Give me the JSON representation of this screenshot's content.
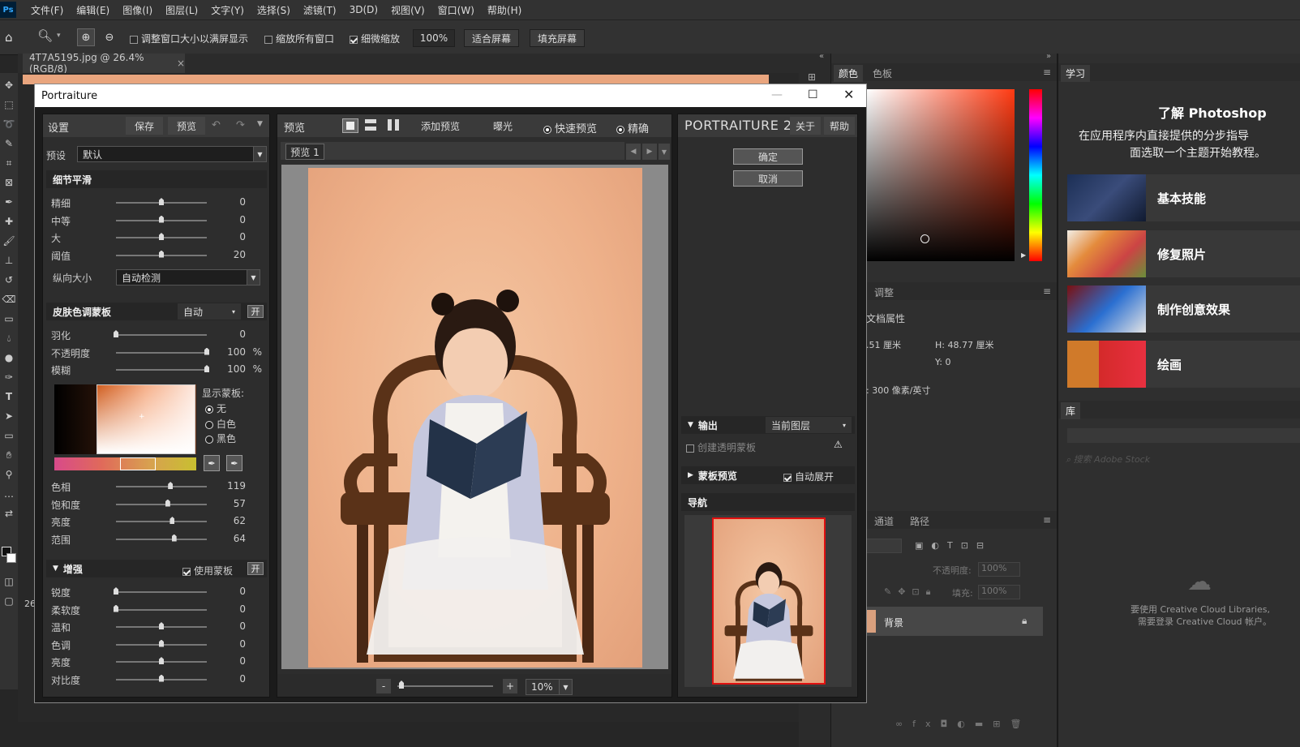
{
  "menubar": {
    "logo": "Ps",
    "items": [
      "文件(F)",
      "编辑(E)",
      "图像(I)",
      "图层(L)",
      "文字(Y)",
      "选择(S)",
      "滤镜(T)",
      "3D(D)",
      "视图(V)",
      "窗口(W)",
      "帮助(H)"
    ]
  },
  "options": {
    "resize_windows": "调整窗口大小以满屏显示",
    "zoom_all": "缩放所有窗口",
    "scrubby_zoom": "细微缩放",
    "zoom_value": "100%",
    "fit_screen": "适合屏幕",
    "fill_screen": "填充屏幕"
  },
  "document": {
    "tab_title": "4T7A5195.jpg @ 26.4%(RGB/8)",
    "close": "×",
    "zoom_readout": "26"
  },
  "right": {
    "tabs_color": [
      "颜色",
      "色板"
    ],
    "learn_tab": "学习",
    "learn_title": "了解 Photoshop",
    "learn_desc1": "在应用程序内直接提供的分步指导",
    "learn_desc2": "面选取一个主题开始教程。",
    "learn_cards": [
      "基本技能",
      "修复照片",
      "制作创意效果",
      "绘画"
    ],
    "adjust_tab": "调整",
    "doc_props": "文档属性",
    "w_val": ".51 厘米",
    "h_val": "H: 48.77 厘米",
    "y_val": "Y: 0",
    "res_val": ": 300 像素/英寸",
    "lib_tab": "库",
    "lib_search": "搜索 Adobe Stock",
    "lib_msg1": "要使用 Creative Cloud Libraries,",
    "lib_msg2": "需要登录 Creative Cloud 帐户。",
    "layers_tabs": [
      "通道",
      "路径"
    ],
    "opacity_label": "不透明度:",
    "opacity_val": "100%",
    "fill_label": "填充:",
    "fill_val": "100%",
    "layer_name": "背景"
  },
  "dialog": {
    "title": "Portraiture",
    "settings": {
      "header": "设置",
      "save": "保存",
      "preview": "预览",
      "preset_label": "预设",
      "preset_value": "默认",
      "detail_smoothing": "细节平滑",
      "detail_sliders": [
        {
          "label": "精细",
          "value": "0",
          "pos": 0.5
        },
        {
          "label": "中等",
          "value": "0",
          "pos": 0.5
        },
        {
          "label": "大",
          "value": "0",
          "pos": 0.5
        },
        {
          "label": "阈值",
          "value": "20",
          "pos": 0.5
        }
      ],
      "size_label": "纵向大小",
      "size_value": "自动检测",
      "skin_mask": "皮肤色调蒙板",
      "skin_mode": "自动",
      "on_label": "开",
      "skin_sliders": [
        {
          "label": "羽化",
          "value": "0",
          "unit": "",
          "pos": 0.0
        },
        {
          "label": "不透明度",
          "value": "100",
          "unit": "%",
          "pos": 1.0
        },
        {
          "label": "模糊",
          "value": "100",
          "unit": "%",
          "pos": 1.0
        }
      ],
      "show_mask": "显示蒙板:",
      "mask_opts": [
        "无",
        "白色",
        "黑色"
      ],
      "hsl_sliders": [
        {
          "label": "色相",
          "value": "119",
          "pos": 0.6
        },
        {
          "label": "饱和度",
          "value": "57",
          "pos": 0.57
        },
        {
          "label": "亮度",
          "value": "62",
          "pos": 0.62
        },
        {
          "label": "范围",
          "value": "64",
          "pos": 0.64
        }
      ],
      "enhance": "增强",
      "use_mask": "使用蒙板",
      "enhance_sliders": [
        {
          "label": "锐度",
          "value": "0",
          "pos": 0.0
        },
        {
          "label": "柔软度",
          "value": "0",
          "pos": 0.0
        },
        {
          "label": "温和",
          "value": "0",
          "pos": 0.5
        },
        {
          "label": "色调",
          "value": "0",
          "pos": 0.5
        },
        {
          "label": "亮度",
          "value": "0",
          "pos": 0.5
        },
        {
          "label": "对比度",
          "value": "0",
          "pos": 0.5
        }
      ]
    },
    "preview": {
      "header": "预览",
      "add_preview": "添加预览",
      "exposure": "曝光",
      "fast_preview": "快速预览",
      "accurate": "精确",
      "tab": "预览 1",
      "zoom_minus": "-",
      "zoom_plus": "+",
      "zoom_value": "10%"
    },
    "right": {
      "brand": "PORTRAITURE 2",
      "about": "关于",
      "help": "帮助",
      "ok": "确定",
      "cancel": "取消",
      "output": "输出",
      "output_value": "当前图层",
      "create_mask": "创建透明蒙板",
      "mask_preview": "蒙板预览",
      "auto_expand": "自动展开",
      "navigator": "导航"
    }
  }
}
